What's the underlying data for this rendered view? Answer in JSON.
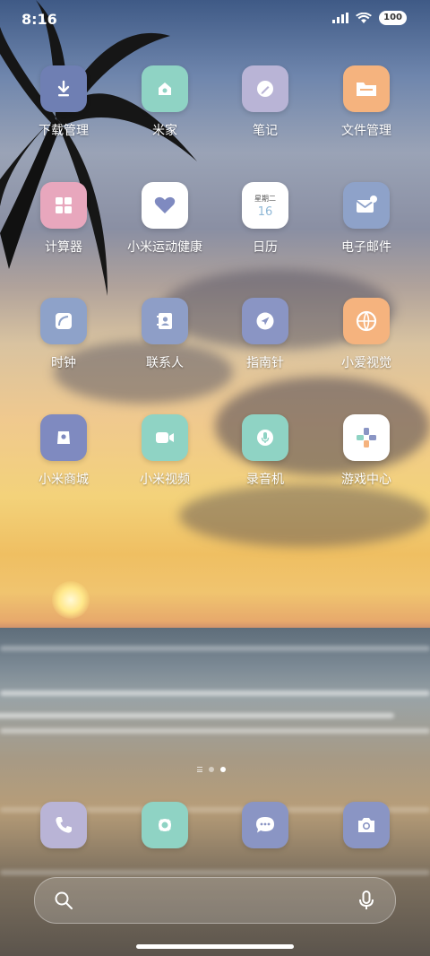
{
  "status_bar": {
    "time": "8:16",
    "battery": "100"
  },
  "apps": [
    {
      "label": "下载管理",
      "icon": "download-icon",
      "color": "#6f7fb3"
    },
    {
      "label": "米家",
      "icon": "mijia-icon",
      "color": "#8fd3c4"
    },
    {
      "label": "笔记",
      "icon": "notes-icon",
      "color": "#b9b4d6"
    },
    {
      "label": "文件管理",
      "icon": "folder-icon",
      "color": "#f5b37e"
    },
    {
      "label": "计算器",
      "icon": "calculator-icon",
      "color": "#e8a7bd"
    },
    {
      "label": "小米运动健康",
      "icon": "heart-icon",
      "color": "#ffffff"
    },
    {
      "label": "日历",
      "icon": "calendar-icon",
      "color": "#ffffff"
    },
    {
      "label": "电子邮件",
      "icon": "email-icon",
      "color": "#8ea2c9"
    },
    {
      "label": "时钟",
      "icon": "clock-icon",
      "color": "#8ea2c9"
    },
    {
      "label": "联系人",
      "icon": "contacts-icon",
      "color": "#8e9ec7"
    },
    {
      "label": "指南针",
      "icon": "compass-icon",
      "color": "#8a95c4"
    },
    {
      "label": "小爱视觉",
      "icon": "xiaoai-vision-icon",
      "color": "#f5b37e"
    },
    {
      "label": "小米商城",
      "icon": "mi-store-icon",
      "color": "#7f8ac0"
    },
    {
      "label": "小米视频",
      "icon": "video-icon",
      "color": "#8fd3c4"
    },
    {
      "label": "录音机",
      "icon": "recorder-icon",
      "color": "#8fd3c4"
    },
    {
      "label": "游戏中心",
      "icon": "game-center-icon",
      "color": "#ffffff"
    }
  ],
  "calendar": {
    "weekday": "星期二",
    "day": "16"
  },
  "dock": [
    {
      "name": "phone",
      "icon": "phone-icon",
      "color": "#b9b4d6"
    },
    {
      "name": "gallery",
      "icon": "gallery-icon",
      "color": "#8fd3c4"
    },
    {
      "name": "messages",
      "icon": "message-icon",
      "color": "#8a95c4"
    },
    {
      "name": "camera",
      "icon": "camera-icon",
      "color": "#8a95c4"
    }
  ],
  "pager": {
    "pages": 3,
    "active": 2
  }
}
